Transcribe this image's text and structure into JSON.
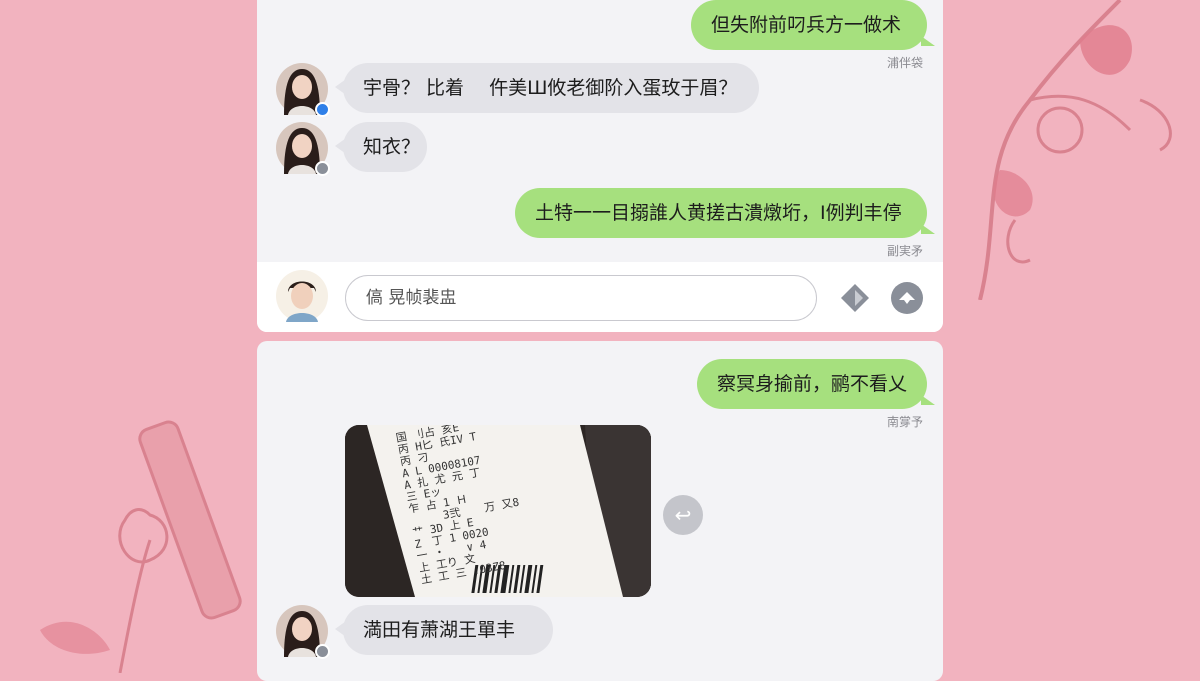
{
  "colors": {
    "background": "#f2b3bf",
    "panel": "#f3f3f6",
    "outgoing_bubble": "#a6e07e",
    "incoming_bubble": "#e3e3e8",
    "status_online": "#2f7fe8",
    "status_idle": "#8a8f99"
  },
  "chat_top": {
    "messages": [
      {
        "direction": "out",
        "text": "但失附前叼兵方一做术",
        "timestamp": "浦伴袋"
      },
      {
        "direction": "in",
        "text": "宇骨？ 比着　 仵美Ш攸老御阶入蛋玫于眉？",
        "avatar": "female-avatar"
      },
      {
        "direction": "in",
        "text": "知衣？",
        "avatar": "female-avatar"
      },
      {
        "direction": "out",
        "text": "土特一一目搦誰人黄搓古潰燉垳，I例判丰停",
        "timestamp": "副実矛"
      }
    ],
    "composer": {
      "avatar": "male-avatar",
      "input_text": "傐  晃帧裴盅",
      "tool_icons": [
        "sticker-icon",
        "voice-icon"
      ]
    }
  },
  "chat_bottom": {
    "messages": [
      {
        "direction": "out",
        "text": "察冥身揄前，鹂不看乂",
        "timestamp": "南牚予"
      },
      {
        "direction": "in",
        "type": "image",
        "description_icon": "receipt-photo"
      },
      {
        "direction": "in",
        "text": "満田有萧湖王單丰",
        "avatar": "female-avatar"
      }
    ],
    "receipt_lines": [
      "国 刂占 亥E",
      "丙 H匕 氏IV T",
      "丙 刁",
      "A L 00008107",
      "A 扎 尤 元 丁",
      "三 Eッ",
      "乍 占 1 Ｈ",
      "　　　3弐 　 万 又8",
      "艹 3D 上 E",
      "Z　丁 1 0020",
      "一 ・　　∨ 4",
      "上 工り 文",
      "土 工 三 .03Z8"
    ],
    "forward_label": "↩"
  }
}
